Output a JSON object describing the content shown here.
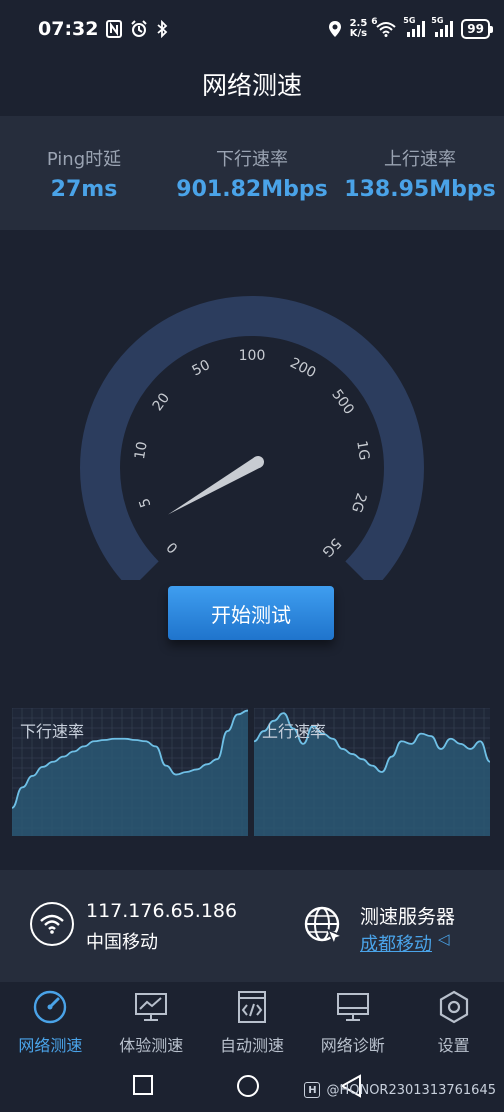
{
  "status_bar": {
    "time": "07:32",
    "net_speed_value": "2.5",
    "net_speed_unit": "K/s",
    "battery": "99",
    "wifi_superscript": "6",
    "signal_label_1": "5G",
    "signal_label_2": "5G"
  },
  "title": "网络测速",
  "stats": {
    "ping_label": "Ping时延",
    "ping_value": "27ms",
    "down_label": "下行速率",
    "down_value": "901.82Mbps",
    "up_label": "上行速率",
    "up_value": "138.95Mbps"
  },
  "gauge": {
    "ticks": [
      "0",
      "5",
      "10",
      "20",
      "50",
      "100",
      "200",
      "500",
      "1G",
      "2G",
      "5G"
    ],
    "needle_value_index": 0
  },
  "start_button": "开始测试",
  "charts": {
    "down_label": "下行速率",
    "up_label": "上行速率",
    "down_series": [
      0.22,
      0.38,
      0.47,
      0.54,
      0.58,
      0.62,
      0.66,
      0.7,
      0.74,
      0.75,
      0.76,
      0.76,
      0.75,
      0.74,
      0.7,
      0.55,
      0.48,
      0.5,
      0.52,
      0.56,
      0.6,
      0.82,
      0.95,
      0.98
    ],
    "up_series": [
      0.74,
      0.82,
      0.9,
      0.96,
      0.84,
      0.72,
      0.86,
      0.8,
      0.76,
      0.68,
      0.64,
      0.6,
      0.55,
      0.5,
      0.62,
      0.74,
      0.72,
      0.8,
      0.78,
      0.68,
      0.76,
      0.72,
      0.68,
      0.74,
      0.58
    ],
    "colors": {
      "line": "#6fc0e6",
      "fill": "#2a5874",
      "grid": "#3a4556",
      "bg": "#1f2738"
    }
  },
  "info": {
    "ip": "117.176.65.186",
    "isp": "中国移动",
    "server_title": "测速服务器",
    "server_name": "成都移动",
    "server_arrow": "◁"
  },
  "nav": {
    "items": [
      {
        "label": "网络测速",
        "icon": "speedometer-icon",
        "active": true
      },
      {
        "label": "体验测速",
        "icon": "monitor-chart-icon",
        "active": false
      },
      {
        "label": "自动测速",
        "icon": "code-document-icon",
        "active": false
      },
      {
        "label": "网络诊断",
        "icon": "monitor-icon",
        "active": false
      },
      {
        "label": "设置",
        "icon": "hexagon-gear-icon",
        "active": false
      }
    ]
  },
  "watermark": {
    "badge": "H",
    "text": "@HONOR2301313761645"
  },
  "colors": {
    "accent": "#4aa3e8",
    "background": "#1c2230",
    "panel": "#262d3c",
    "gauge_track": "#2c3d5e"
  }
}
